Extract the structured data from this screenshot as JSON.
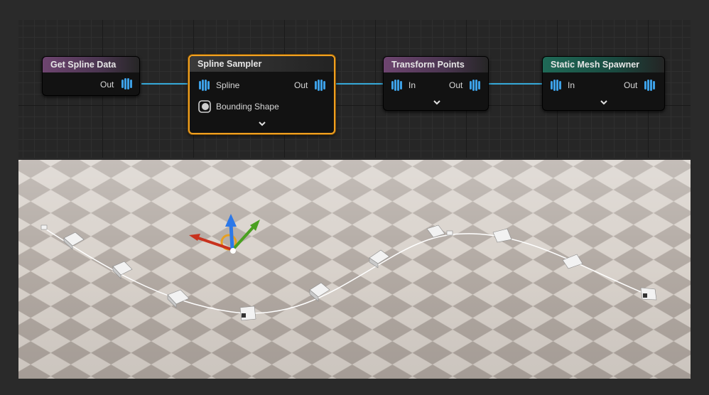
{
  "graph": {
    "nodes": [
      {
        "title": "Get Spline Data",
        "outputs": [
          "Out"
        ]
      },
      {
        "title": "Spline Sampler",
        "inputs": [
          "Spline",
          "Bounding Shape"
        ],
        "outputs": [
          "Out"
        ],
        "selected": true
      },
      {
        "title": "Transform Points",
        "inputs": [
          "In"
        ],
        "outputs": [
          "Out"
        ]
      },
      {
        "title": "Static Mesh Spawner",
        "inputs": [
          "In"
        ],
        "outputs": [
          "Out"
        ]
      }
    ],
    "colors": {
      "canvas": "#262626",
      "node_body": "#121212",
      "header_purple": "#6e4570",
      "header_green": "#1f6a57",
      "selection": "#f0a020",
      "wire": "#34a8d8",
      "pin": "#3da0e6"
    }
  },
  "viewport": {
    "colors": {
      "checker_light": "#d8d1ca",
      "checker_dark": "#aba29b",
      "spline": "#ffffff"
    },
    "gizmo": {
      "axes": [
        "x-red",
        "y-green",
        "z-blue"
      ]
    }
  }
}
